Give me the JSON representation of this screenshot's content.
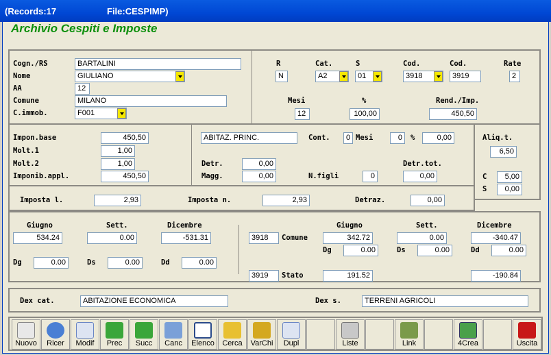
{
  "title": {
    "records": "(Records:17",
    "file": "File:CESPIMP)"
  },
  "app_title": "Archivio Cespiti e Imposte",
  "anagrafica": {
    "cognome_label": "Cogn./RS",
    "cognome": "BARTALINI",
    "nome_label": "Nome",
    "nome": "GIULIANO",
    "aa_label": "AA",
    "aa": "12",
    "comune_label": "Comune",
    "comune": "MILANO",
    "cimmob_label": "C.immob.",
    "cimmob": "F001"
  },
  "catasto": {
    "r_label": "R",
    "r": "N",
    "cat_label": "Cat.",
    "cat": "A2",
    "s_label": "S",
    "s": "01",
    "cod1_label": "Cod.",
    "cod1": "3918",
    "cod2_label": "Cod.",
    "cod2": "3919",
    "rate_label": "Rate",
    "rate": "2",
    "mesi_label": "Mesi",
    "mesi": "12",
    "perc_label": "%",
    "perc": "100,00",
    "rend_label": "Rend./Imp.",
    "rend": "450,50"
  },
  "imponibile": {
    "base_label": "Impon.base",
    "base": "450,50",
    "molt1_label": "Molt.1",
    "molt1": "1,00",
    "molt2_label": "Molt.2",
    "molt2": "1,00",
    "appl_label": "Imponib.appl.",
    "appl": "450,50"
  },
  "detrazioni": {
    "desc": "ABITAZ. PRINC.",
    "cont_label": "Cont.",
    "cont": "0",
    "mesi_label": "Mesi",
    "mesi": "0",
    "perc_label": "%",
    "perc": "0,00",
    "detr_label": "Detr.",
    "detr": "0,00",
    "magg_label": "Magg.",
    "magg": "0,00",
    "nfigli_label": "N.figli",
    "nfigli": "0",
    "detrtot_label": "Detr.tot.",
    "detrtot": "0,00"
  },
  "aliquote": {
    "aliqt_label": "Aliq.t.",
    "aliqt": "6,50",
    "c_label": "C",
    "c": "5,00",
    "s_label": "S",
    "s": "0,00"
  },
  "imposte": {
    "imp1_label": "Imposta l.",
    "imp1": "2,93",
    "impn_label": "Imposta n.",
    "impn": "2,93",
    "detraz_label": "Detraz.",
    "detraz": "0,00"
  },
  "rate": {
    "giugno_label": "Giugno",
    "giugno": "534.24",
    "sett_label": "Sett.",
    "sett": "0.00",
    "dic_label": "Dicembre",
    "dic": "-531.31",
    "dg_label": "Dg",
    "dg": "0.00",
    "ds_label": "Ds",
    "ds": "0.00",
    "dd_label": "Dd",
    "dd": "0.00",
    "cod_comune": "3918",
    "comune_label": "Comune",
    "c_giugno": "342.72",
    "c_sett": "0.00",
    "c_dic": "-340.47",
    "c_dg": "0.00",
    "c_ds": "0.00",
    "c_dd": "0.00",
    "cod_stato": "3919",
    "stato_label": "Stato",
    "s_giugno": "191.52",
    "s_dic": "-190.84"
  },
  "dex": {
    "cat_label": "Dex cat.",
    "cat": "ABITAZIONE ECONOMICA",
    "s_label": "Dex s.",
    "s": "TERRENI AGRICOLI"
  },
  "toolbar": {
    "nuovo": "Nuovo",
    "ricer": "Ricer",
    "modif": "Modif",
    "prec": "Prec",
    "succ": "Succ",
    "canc": "Canc",
    "elenco": "Elenco",
    "cerca": "Cerca",
    "varchi": "VarChi",
    "dupl": "Dupl",
    "liste": "Liste",
    "link": "Link",
    "crea": "4Crea",
    "uscita": "Uscita"
  }
}
